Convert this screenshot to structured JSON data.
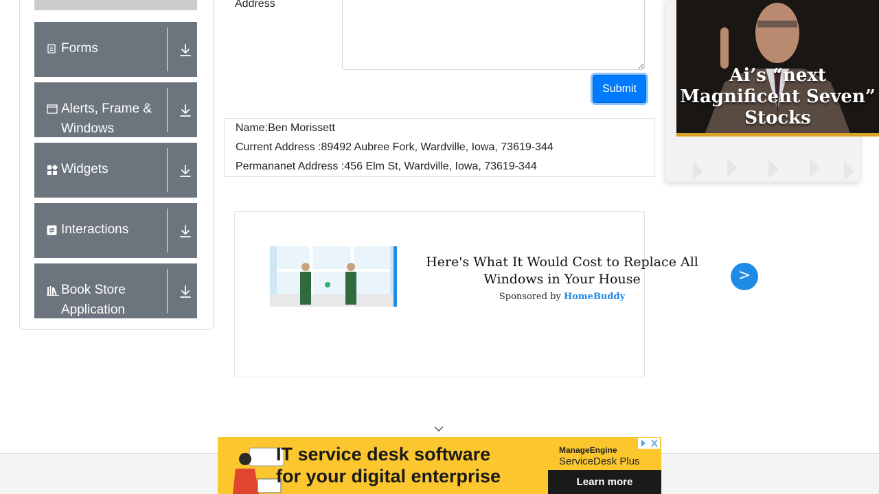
{
  "sidebar": {
    "groups": [
      {
        "label": "Forms",
        "icon": "document-icon"
      },
      {
        "label": "Alerts, Frame & Windows",
        "icon": "window-icon"
      },
      {
        "label": "Widgets",
        "icon": "widgets-icon"
      },
      {
        "label": "Interactions",
        "icon": "interactions-icon"
      },
      {
        "label": "Book Store Application",
        "icon": "books-icon"
      }
    ],
    "toggle_icon": "download-arrow-icon",
    "header_bg": "#6c757d"
  },
  "form": {
    "permanent_address_label": "Address",
    "permanent_address_value": "",
    "submit_label": "Submit",
    "submit_color": "#007bff"
  },
  "output": {
    "name": "Name:Ben Morissett",
    "current_address": "Current Address :89492 Aubree Fork, Wardville, Iowa, 73619-344",
    "permanent_address": "Permananet Address :456 Elm St, Wardville, Iowa, 73619-344"
  },
  "sponsored_ad": {
    "headline": "Here's What It Would Cost to Replace All Windows in Your House",
    "sponsored_prefix": "Sponsored by",
    "sponsor": "HomeBuddy",
    "arrow": ">",
    "accent_color": "#1e8be6"
  },
  "right_ad": {
    "headline": "Ai’s “next Magnificent Seven” Stocks"
  },
  "bottom_banner": {
    "line1": "IT service desk software",
    "line2": "for your digital enterprise",
    "brand_top": "ManageEngine",
    "brand_name": "ServiceDesk Plus",
    "cta": "Learn more",
    "background": "#fcc72e"
  }
}
